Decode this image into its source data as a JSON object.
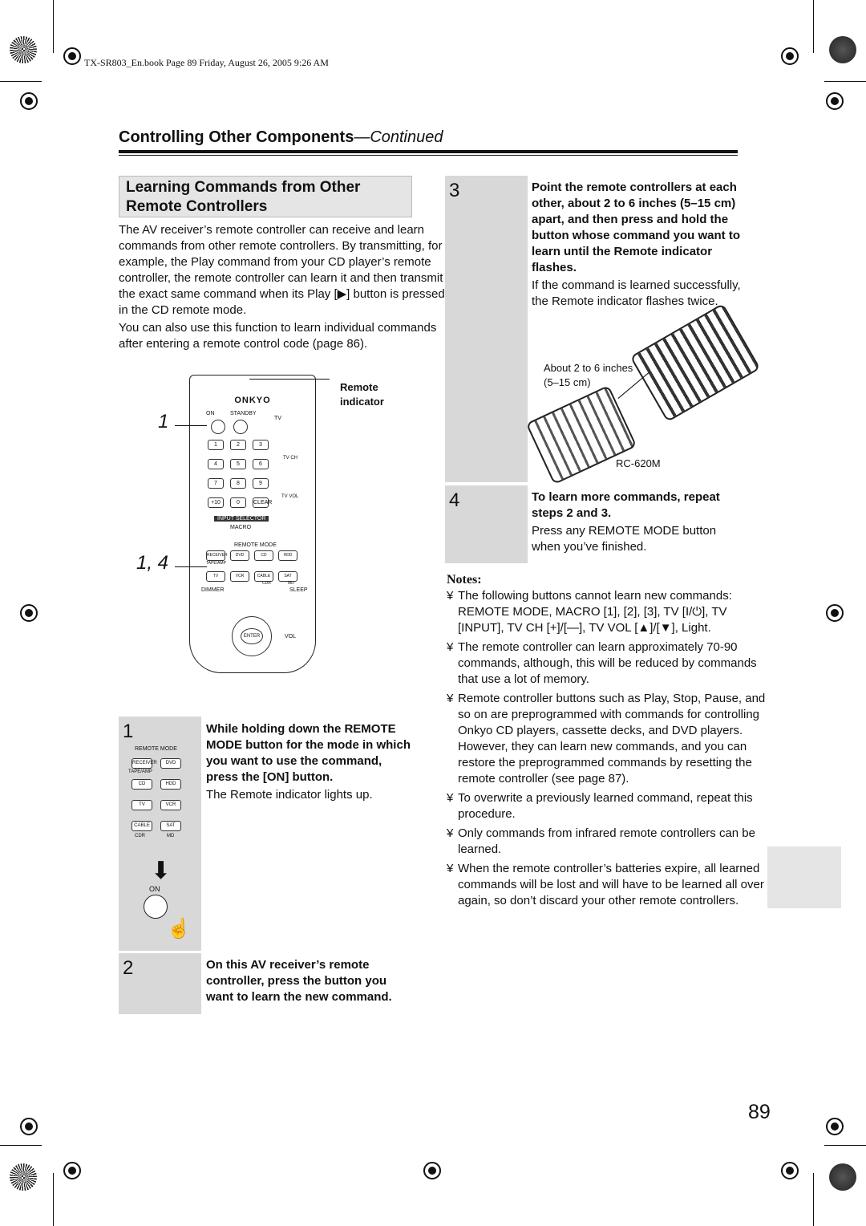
{
  "header": {
    "book_line": "TX-SR803_En.book  Page 89  Friday, August 26, 2005  9:26 AM",
    "title": "Controlling Other Components",
    "title_suffix": "—Continued"
  },
  "section": {
    "heading": "Learning Commands from Other Remote Controllers",
    "intro": "The AV receiver’s remote controller can receive and learn commands from other remote controllers. By transmitting, for example, the Play command from your CD player’s remote controller, the remote controller can learn it and then transmit the exact same command when its Play [▶] button is pressed in the CD remote mode.",
    "intro2": "You can also use this function to learn individual commands after entering a remote control code (page 86)."
  },
  "remote_figure": {
    "callout_1": "1",
    "callout_14": "1, 4",
    "remote_indicator_label": "Remote indicator",
    "brand": "ONKYO",
    "labels": {
      "on": "ON",
      "standby": "STANDBY",
      "tv": "TV",
      "input_selector": "INPUT SELECTOR",
      "macro": "MACRO",
      "remote_mode": "REMOTE MODE",
      "dimmer": "DIMMER",
      "sleep": "SLEEP",
      "enter": "ENTER",
      "vol": "VOL",
      "tv_ch": "TV CH",
      "tv_vol": "TV VOL",
      "tape_amp": "TAPE/AMP",
      "cdr": "CDR",
      "md": "MD"
    },
    "mode_buttons": [
      "RECEIVER",
      "DVD",
      "CD",
      "HDD",
      "TV",
      "VCR",
      "CABLE",
      "SAT"
    ],
    "num_keys": [
      "1",
      "2",
      "3",
      "4",
      "5",
      "6",
      "7",
      "8",
      "9",
      "+10",
      "0",
      "CLEAR"
    ]
  },
  "steps": [
    {
      "num": "1",
      "instruction": "While holding down the REMOTE MODE button for the mode in which you want to use the command, press the [ON] button.",
      "result": "The Remote indicator lights up.",
      "fig_label": "REMOTE MODE",
      "fig_on": "ON"
    },
    {
      "num": "2",
      "instruction": "On this AV receiver’s remote controller, press the button you want to learn the new command."
    },
    {
      "num": "3",
      "instruction": "Point the remote controllers at each other, about 2 to 6 inches (5–15 cm) apart, and then press and hold the button whose command you want to learn until the Remote indicator flashes.",
      "result": "If the command is learned successfully, the Remote indicator ﬂashes twice.",
      "fig_distance": "About 2 to 6 inches (5–15 cm)",
      "fig_model": "RC-620M"
    },
    {
      "num": "4",
      "instruction": "To learn more commands, repeat steps 2 and 3.",
      "result": "Press any REMOTE MODE button when you’ve ﬁnished."
    }
  ],
  "notes": {
    "heading": "Notes:",
    "bullet": "¥",
    "items": [
      "The following buttons cannot learn new commands: REMOTE MODE, MACRO [1], [2], [3], TV [I/⏻], TV [INPUT], TV CH [+]/[—], TV VOL [▲]/[▼], Light.",
      "The remote controller can learn approximately 70-90 commands, although, this will be reduced by commands that use a lot of memory.",
      "Remote controller buttons such as Play, Stop, Pause, and so on are preprogrammed with commands for controlling Onkyo CD players, cassette decks, and DVD players. However, they can learn new commands, and you can restore the preprogrammed commands by resetting the remote controller (see page 87).",
      "To overwrite a previously learned command, repeat this procedure.",
      "Only commands from infrared remote controllers can be learned.",
      "When the remote controller’s batteries expire, all learned commands will be lost and will have to be learned all over again, so don’t discard your other remote controllers."
    ]
  },
  "page_number": "89"
}
